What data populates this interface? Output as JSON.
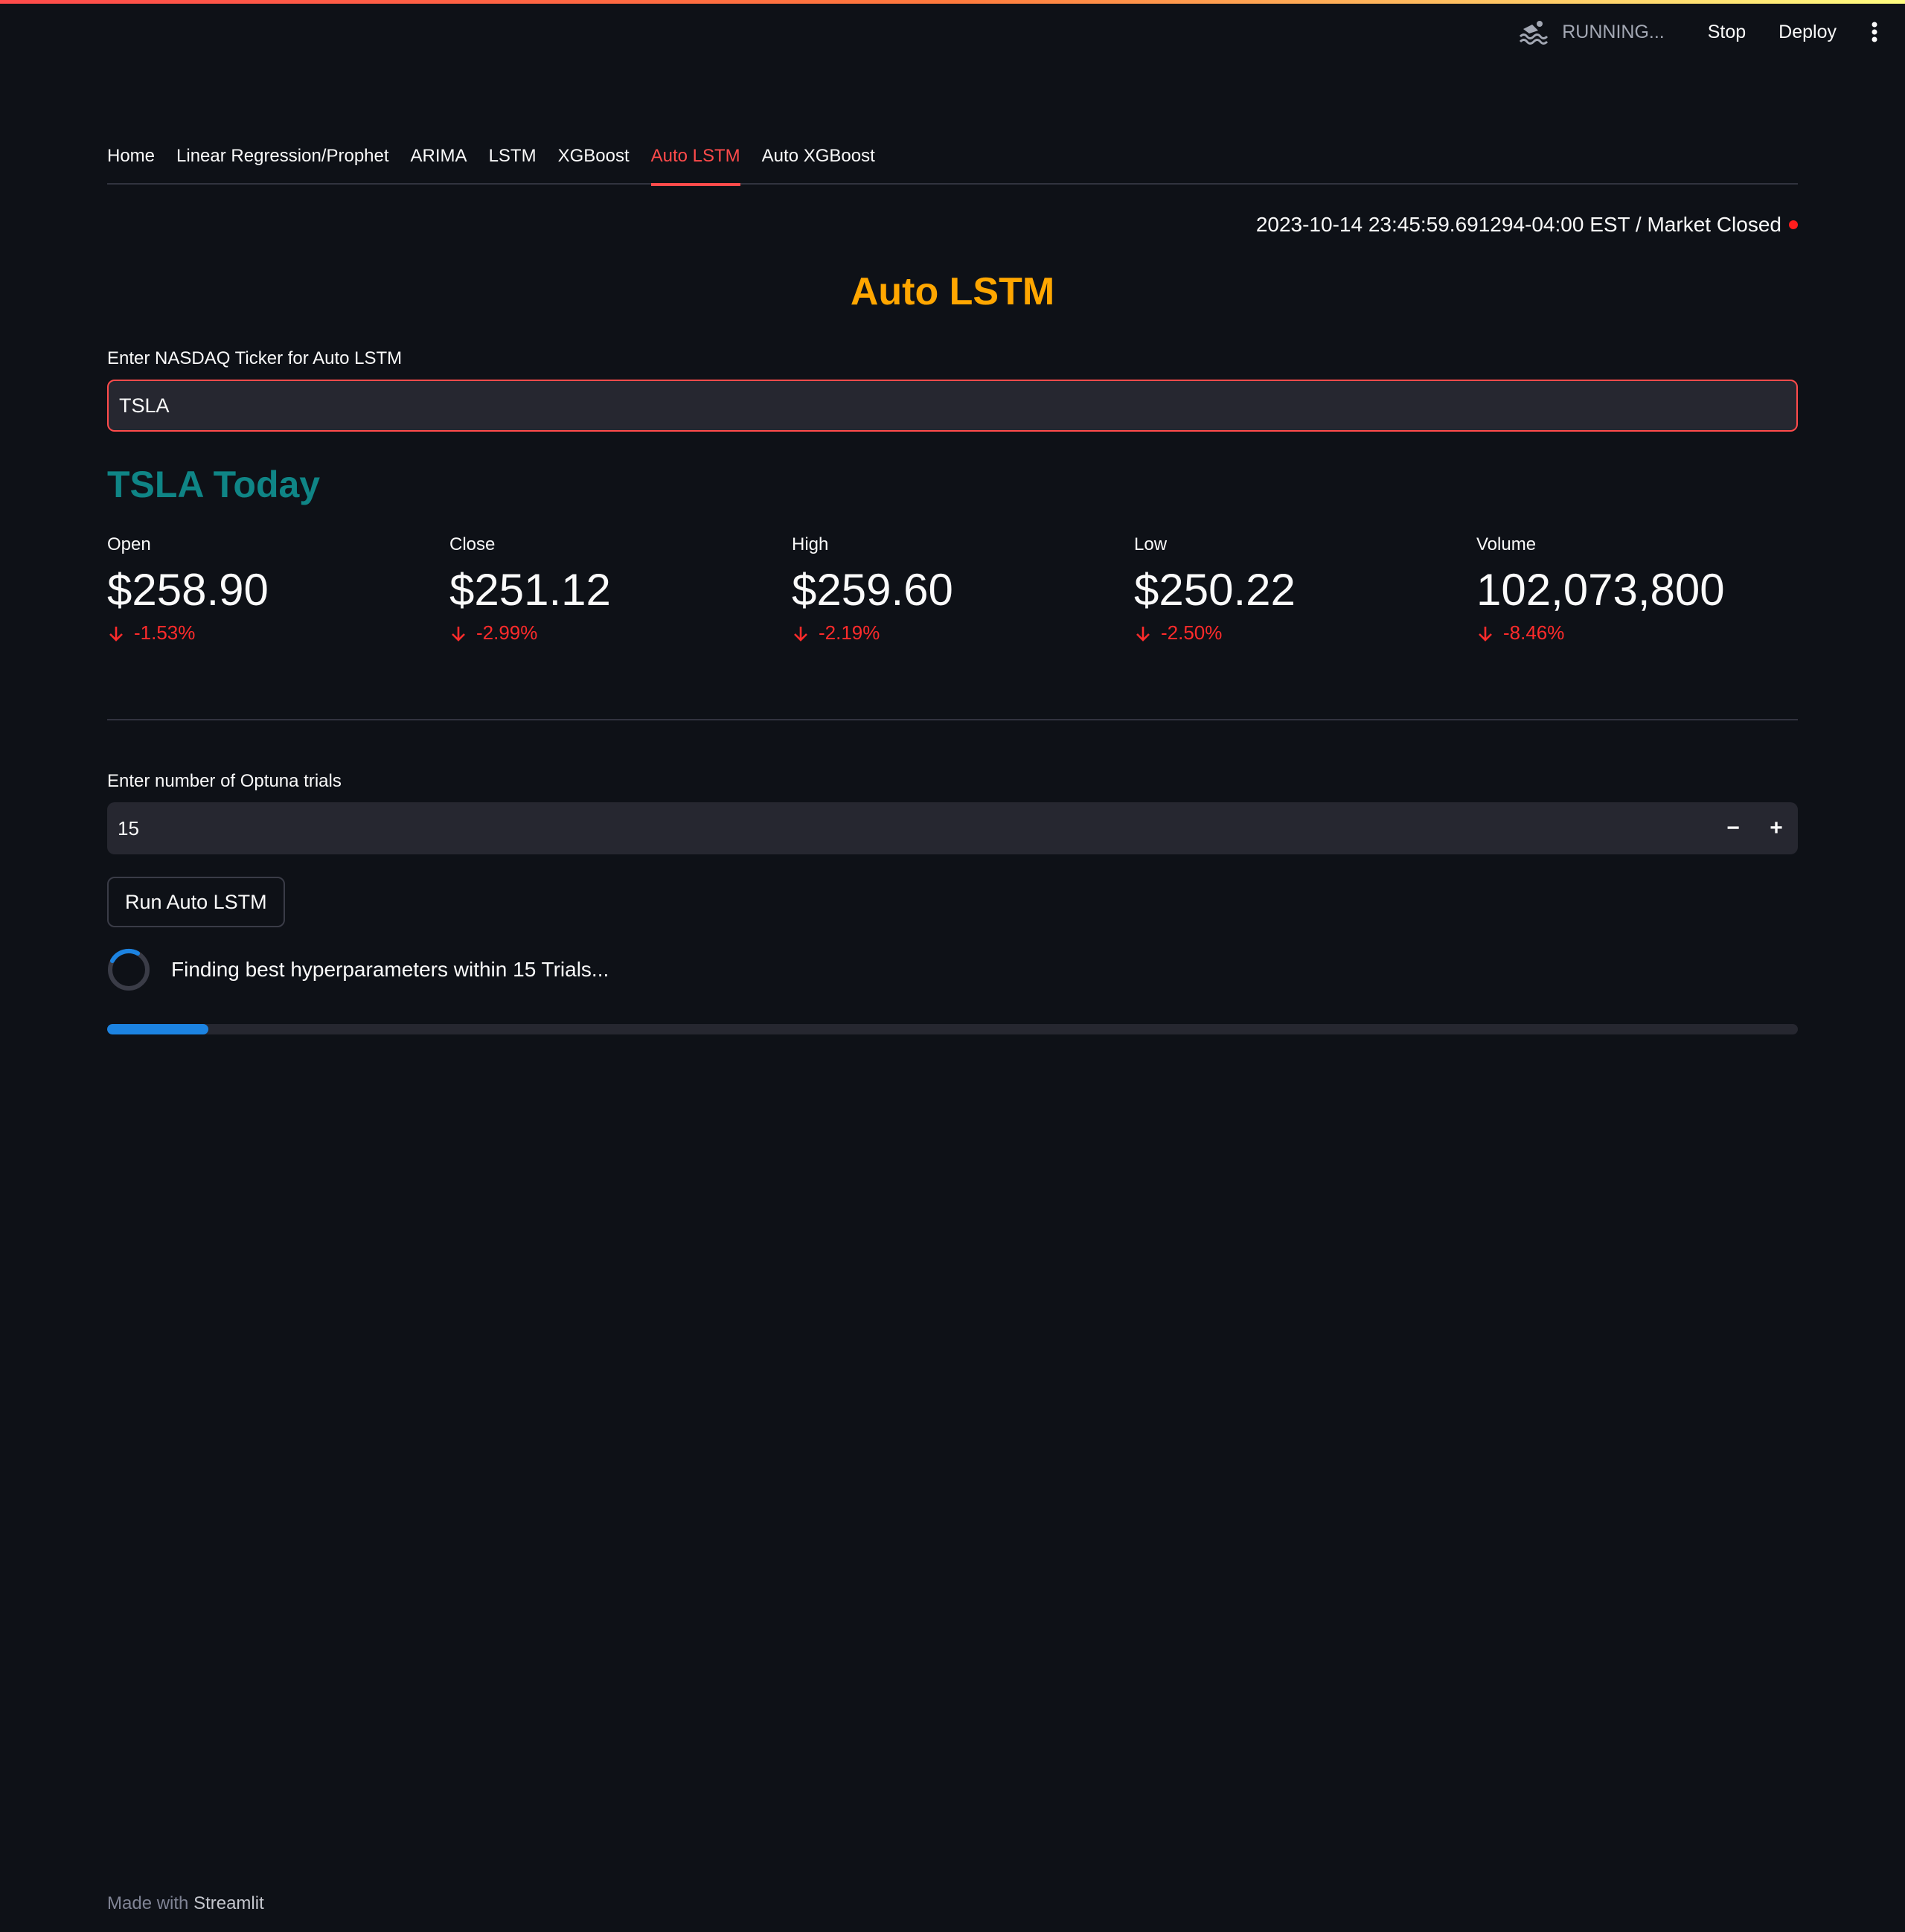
{
  "toolbar": {
    "status": "RUNNING...",
    "stop_label": "Stop",
    "deploy_label": "Deploy",
    "status_icon": "swimmer-icon",
    "menu_icon": "vertical-ellipsis-icon"
  },
  "tabs": [
    {
      "label": "Home",
      "active": false
    },
    {
      "label": "Linear Regression/Prophet",
      "active": false
    },
    {
      "label": "ARIMA",
      "active": false
    },
    {
      "label": "LSTM",
      "active": false
    },
    {
      "label": "XGBoost",
      "active": false
    },
    {
      "label": "Auto LSTM",
      "active": true
    },
    {
      "label": "Auto XGBoost",
      "active": false
    }
  ],
  "market": {
    "timestamp": "2023-10-14 23:45:59.691294-04:00 EST / Market Closed",
    "status_color": "#ff1d1d"
  },
  "page": {
    "title": "Auto LSTM",
    "title_color": "#ffa600"
  },
  "ticker": {
    "label": "Enter NASDAQ Ticker for Auto LSTM",
    "value": "TSLA"
  },
  "today": {
    "heading": "TSLA Today",
    "heading_color": "#0f8586",
    "metrics": [
      {
        "label": "Open",
        "value": "$258.90",
        "delta": "-1.53%"
      },
      {
        "label": "Close",
        "value": "$251.12",
        "delta": "-2.99%"
      },
      {
        "label": "High",
        "value": "$259.60",
        "delta": "-2.19%"
      },
      {
        "label": "Low",
        "value": "$250.22",
        "delta": "-2.50%"
      },
      {
        "label": "Volume",
        "value": "102,073,800",
        "delta": "-8.46%"
      }
    ],
    "delta_color": "#ff2b2b"
  },
  "trials": {
    "label": "Enter number of Optuna trials",
    "value": "15",
    "decrement": "−",
    "increment": "+"
  },
  "run_button": "Run Auto LSTM",
  "spinner": {
    "text": "Finding best hyperparameters within 15 Trials..."
  },
  "progress": {
    "fraction": 0.06,
    "color": "#1c83e1"
  },
  "footer": {
    "prefix": "Made with",
    "brand": "Streamlit"
  }
}
